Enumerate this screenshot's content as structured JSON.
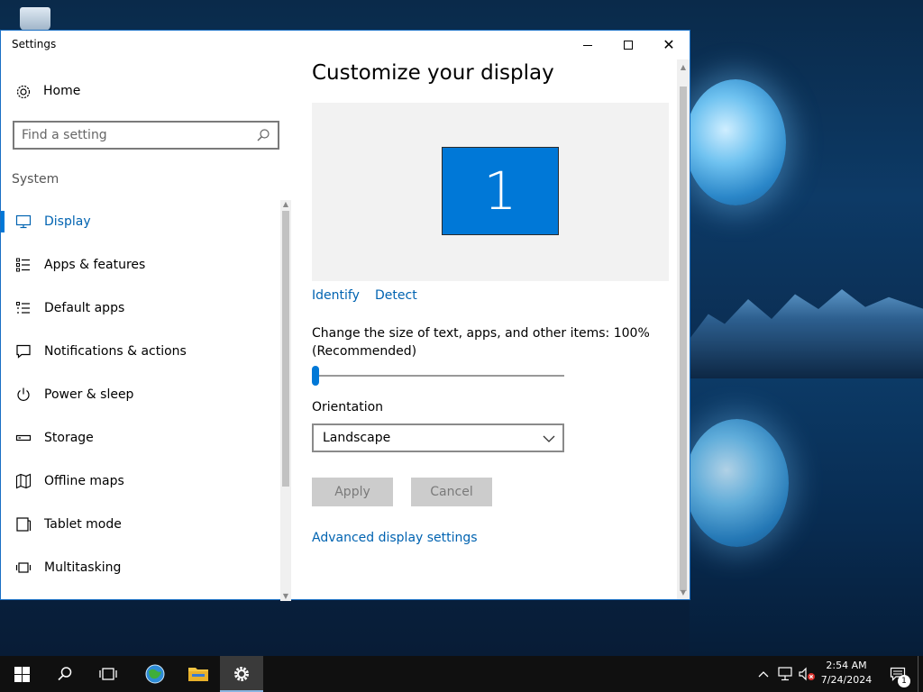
{
  "window": {
    "title": "Settings",
    "minimize_label": "—",
    "maximize_label": "☐",
    "close_label": "✕"
  },
  "sidebar": {
    "home_label": "Home",
    "search_placeholder": "Find a setting",
    "section_label": "System",
    "items": [
      {
        "label": "Display",
        "icon": "monitor-icon",
        "selected": true
      },
      {
        "label": "Apps & features",
        "icon": "apps-list-icon"
      },
      {
        "label": "Default apps",
        "icon": "default-apps-icon"
      },
      {
        "label": "Notifications & actions",
        "icon": "notification-icon"
      },
      {
        "label": "Power & sleep",
        "icon": "power-icon"
      },
      {
        "label": "Storage",
        "icon": "storage-icon"
      },
      {
        "label": "Offline maps",
        "icon": "map-icon"
      },
      {
        "label": "Tablet mode",
        "icon": "tablet-icon"
      },
      {
        "label": "Multitasking",
        "icon": "multitasking-icon"
      }
    ]
  },
  "main": {
    "title": "Customize your display",
    "monitor_number": "1",
    "identify_label": "Identify",
    "detect_label": "Detect",
    "scale_label": "Change the size of text, apps, and other items: 100% (Recommended)",
    "scale_value_fraction": 0,
    "orientation_label": "Orientation",
    "orientation_value": "Landscape",
    "apply_label": "Apply",
    "cancel_label": "Cancel",
    "advanced_label": "Advanced display settings"
  },
  "taskbar": {
    "time": "2:54 AM",
    "date": "7/24/2024",
    "notification_count": "1"
  },
  "colors": {
    "accent": "#0078d7",
    "link": "#0063b1",
    "taskbar": "#101010"
  }
}
